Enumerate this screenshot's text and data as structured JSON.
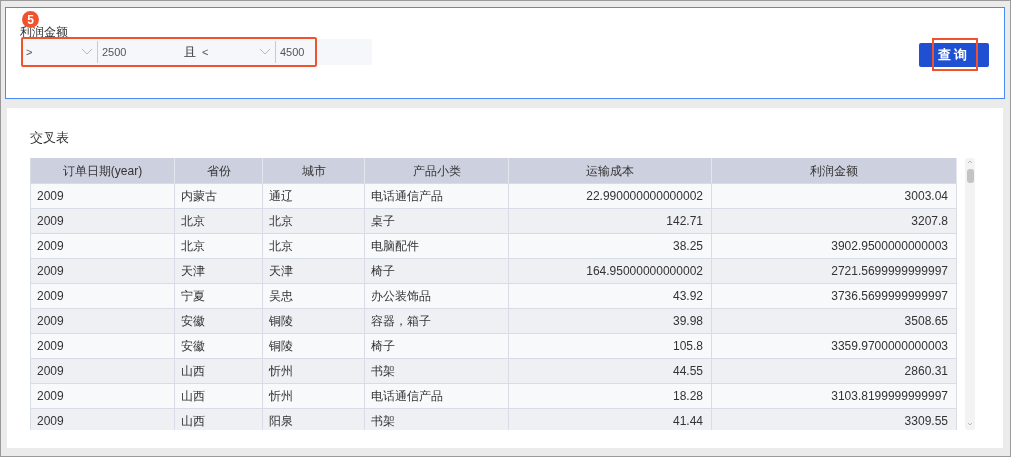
{
  "filter": {
    "label": "利润金额",
    "badge": "5",
    "operator_1": ">",
    "value_1": "2500",
    "joiner": "且",
    "operator_2": "<",
    "value_2": "4500",
    "highlighted": true
  },
  "query_button": {
    "label": "查询",
    "highlighted": true
  },
  "table": {
    "title": "交叉表",
    "columns": [
      {
        "label": "订单日期(year)",
        "kind": "text"
      },
      {
        "label": "省份",
        "kind": "text"
      },
      {
        "label": "城市",
        "kind": "text"
      },
      {
        "label": "产品小类",
        "kind": "text"
      },
      {
        "label": "运输成本",
        "kind": "number"
      },
      {
        "label": "利润金额",
        "kind": "number"
      }
    ],
    "rows": [
      [
        "2009",
        "内蒙古",
        "通辽",
        "电话通信产品",
        "22.990000000000002",
        "3003.04"
      ],
      [
        "2009",
        "北京",
        "北京",
        "桌子",
        "142.71",
        "3207.8"
      ],
      [
        "2009",
        "北京",
        "北京",
        "电脑配件",
        "38.25",
        "3902.9500000000003"
      ],
      [
        "2009",
        "天津",
        "天津",
        "椅子",
        "164.95000000000002",
        "2721.5699999999997"
      ],
      [
        "2009",
        "宁夏",
        "吴忠",
        "办公装饰品",
        "43.92",
        "3736.5699999999997"
      ],
      [
        "2009",
        "安徽",
        "铜陵",
        "容器，箱子",
        "39.98",
        "3508.65"
      ],
      [
        "2009",
        "安徽",
        "铜陵",
        "椅子",
        "105.8",
        "3359.9700000000003"
      ],
      [
        "2009",
        "山西",
        "忻州",
        "书架",
        "44.55",
        "2860.31"
      ],
      [
        "2009",
        "山西",
        "忻州",
        "电话通信产品",
        "18.28",
        "3103.8199999999997"
      ],
      [
        "2009",
        "山西",
        "阳泉",
        "书架",
        "41.44",
        "3309.55"
      ]
    ]
  }
}
